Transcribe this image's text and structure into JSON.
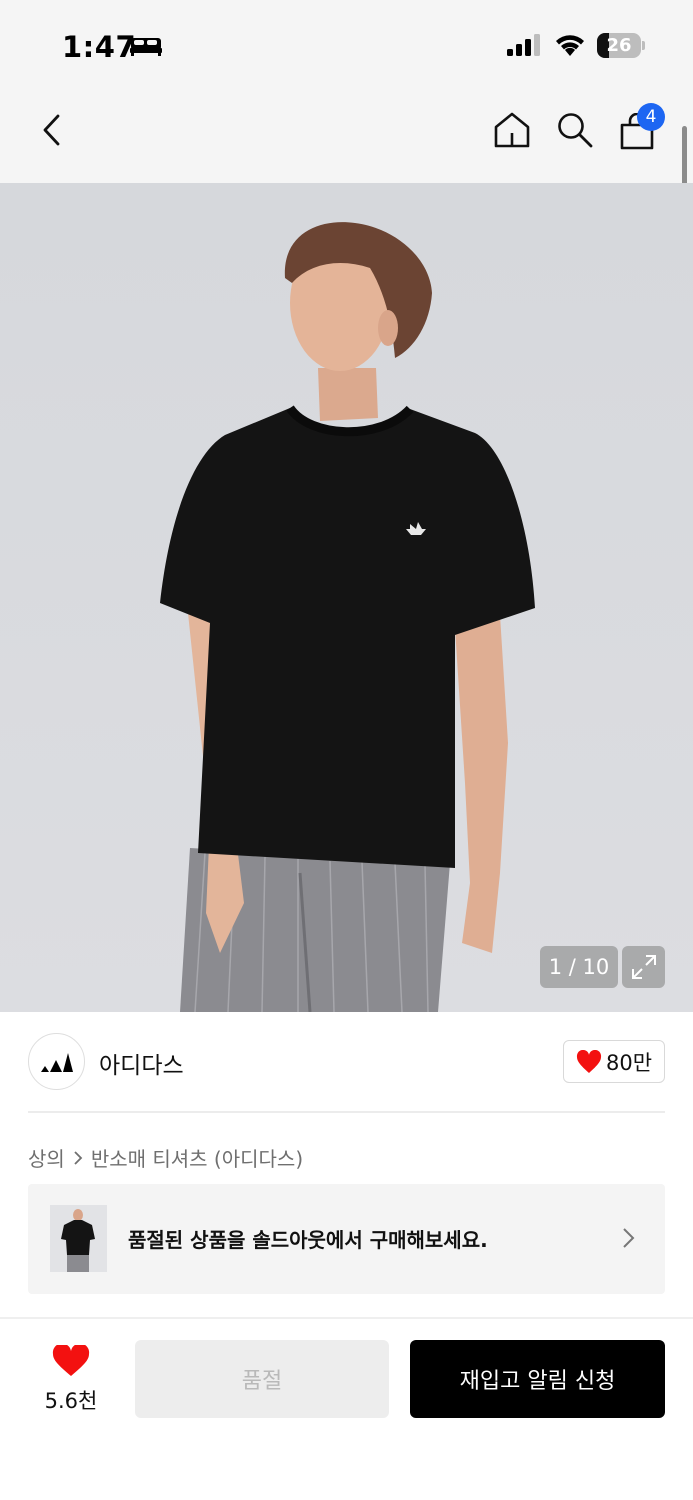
{
  "status_bar": {
    "time": "1:47",
    "battery_level": "26",
    "icons": [
      "bed-icon",
      "signal-icon",
      "wifi-icon",
      "battery-icon"
    ]
  },
  "nav": {
    "icons": [
      "back-chevron-icon",
      "home-icon",
      "search-icon",
      "shopping-bag-icon"
    ],
    "cart_count": "4"
  },
  "product_image": {
    "page_indicator": "1 / 10",
    "icons": [
      "expand-icon"
    ]
  },
  "brand": {
    "name": "아디다스",
    "likes": "80만",
    "icons": [
      "adidas-logo-icon",
      "heart-icon"
    ]
  },
  "breadcrumb": {
    "category": "상의",
    "subcategory": "반소매 티셔츠 (아디다스)",
    "separator_icon": "chevron-right-icon"
  },
  "soldout_banner": {
    "text": "품절된 상품을 솔드아웃에서 구매해보세요.",
    "icon": "chevron-right-icon"
  },
  "bottom_bar": {
    "wish_count": "5.6천",
    "soldout_label": "품절",
    "restock_label": "재입고 알림 신청",
    "icons": [
      "heart-icon"
    ]
  },
  "colors": {
    "accent_red": "#f31110",
    "badge_blue": "#1d66f2",
    "primary_black": "#000000",
    "disabled_gray": "#ededed"
  }
}
